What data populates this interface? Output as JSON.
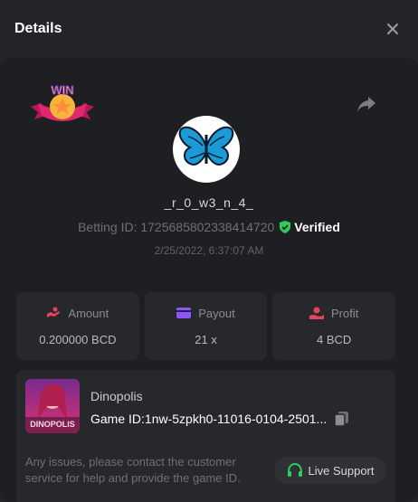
{
  "header": {
    "title": "Details"
  },
  "player": {
    "username": "_r_0_w3_n_4_",
    "betting_label": "Betting ID: 1725685802338414720",
    "verified_label": "Verified",
    "date": "2/25/2022, 6:37:07 AM",
    "badge_text": "WIN"
  },
  "stats": {
    "amount": {
      "label": "Amount",
      "value": "0.200000 BCD"
    },
    "payout": {
      "label": "Payout",
      "value": "21 x"
    },
    "profit": {
      "label": "Profit",
      "value": "4 BCD"
    }
  },
  "game": {
    "name": "Dinopolis",
    "thumb_text": "DINOPOLIS",
    "id_label": "Game ID:1nw-5zpkh0-11016-0104-2501...",
    "notice": "Any issues, please contact the customer service for help and provide the game ID.",
    "support_label": "Live Support"
  },
  "colors": {
    "amount_icon": "#e8425f",
    "payout_icon": "#8c57f2",
    "profit_icon": "#e8425f",
    "verified_icon": "#2fcc5a",
    "support_icon": "#2fcc5a"
  }
}
